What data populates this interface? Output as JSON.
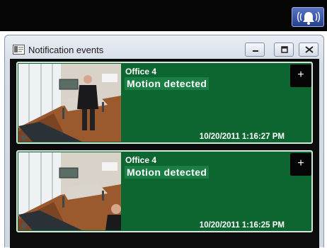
{
  "window": {
    "title": "Notification events"
  },
  "events": [
    {
      "camera": "Office 4",
      "event": "Motion detected",
      "timestamp": "10/20/2011 1:16:27 PM",
      "expand_label": "+"
    },
    {
      "camera": "Office 4",
      "event": "Motion detected",
      "timestamp": "10/20/2011 1:16:25 PM",
      "expand_label": "+"
    }
  ],
  "icons": {
    "alarm": "alarm-bell-icon",
    "window": "window-app-icon",
    "minimize": "minimize-icon",
    "restore": "restore-icon",
    "close": "close-icon",
    "camera": "camera-icon"
  },
  "colors": {
    "card_background": "#0d6630",
    "event_label_background": "#1b7f45",
    "alarm_button": "#3a55a8"
  }
}
